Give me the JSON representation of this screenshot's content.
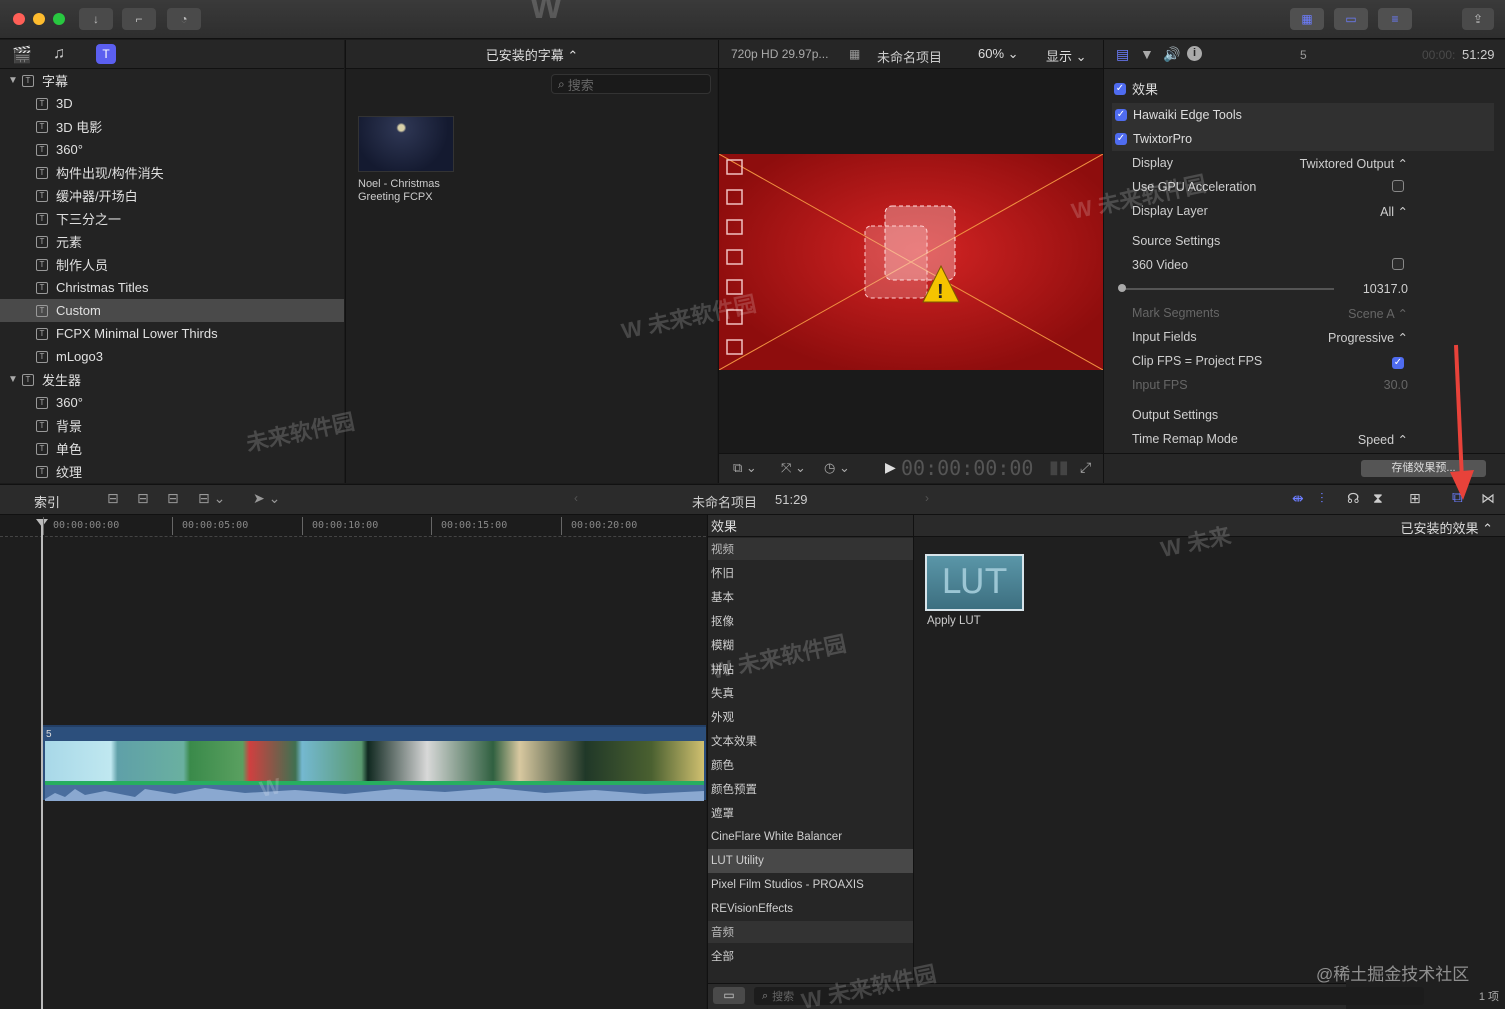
{
  "titlebar": {
    "buttons": [
      "download-icon",
      "key-icon",
      "clock-icon"
    ],
    "right_buttons": [
      "grid-icon",
      "filmstrip-icon",
      "sliders-icon",
      "share-icon"
    ]
  },
  "library": {
    "title": "已安装的字幕 ⌃",
    "search_placeholder": "搜索",
    "sections": [
      {
        "label": "字幕",
        "items": [
          "3D",
          "3D 电影",
          "360°",
          "构件出现/构件消失",
          "缓冲器/开场白",
          "下三分之一",
          "元素",
          "制作人员",
          "Christmas Titles",
          "Custom",
          "FCPX Minimal Lower Thirds",
          "mLogo3"
        ]
      },
      {
        "label": "发生器",
        "items": [
          "360°",
          "背景",
          "单色",
          "纹理"
        ]
      }
    ],
    "selected": "Custom"
  },
  "browser": {
    "clip_title": "Noel - Christmas Greeting FCPX"
  },
  "viewer": {
    "format": "720p HD 29.97p...",
    "project": "未命名项目",
    "zoom": "60% ⌄",
    "display": "显示 ⌄",
    "timecode": "00:00:00:00"
  },
  "inspector": {
    "index": "5",
    "duration_dim": "00:00:",
    "duration": "51:29",
    "effects_header": "效果",
    "rows": [
      {
        "label": "Hawaiki Edge Tools",
        "type": "effect"
      },
      {
        "label": "TwixtorPro",
        "type": "effect"
      },
      {
        "label": "Display",
        "value": "Twixtored Output ⌃"
      },
      {
        "label": "Use GPU Acceleration",
        "value": "checkbox-off"
      },
      {
        "label": "Display Layer",
        "value": "All ⌃"
      },
      {
        "label": "Source Settings",
        "value": ""
      },
      {
        "label": "360 Video",
        "value": "checkbox-off"
      },
      {
        "label": "",
        "value": "10317.0"
      },
      {
        "label": "Mark Segments",
        "value": "Scene A ⌃",
        "dim": true
      },
      {
        "label": "Input Fields",
        "value": "Progressive ⌃"
      },
      {
        "label": "Clip FPS = Project FPS",
        "value": "checkbox-on"
      },
      {
        "label": "Input FPS",
        "value": "30.0",
        "dim": true
      },
      {
        "label": "Output Settings",
        "value": ""
      },
      {
        "label": "Time Remap Mode",
        "value": "Speed ⌃"
      }
    ],
    "save_preset": "存储效果预..."
  },
  "timeline": {
    "index_label": "索引",
    "project": "未命名项目",
    "duration": "51:29",
    "ruler": [
      "00:00:00:00",
      "00:00:05:00",
      "00:00:10:00",
      "00:00:15:00",
      "00:00:20:00"
    ],
    "clip_index": "5"
  },
  "effects": {
    "header": "效果",
    "installed": "已安装的效果 ⌃",
    "categories": [
      {
        "label": "视频",
        "hdr": true
      },
      {
        "label": "怀旧"
      },
      {
        "label": "基本"
      },
      {
        "label": "抠像"
      },
      {
        "label": "模糊"
      },
      {
        "label": "拼贴"
      },
      {
        "label": "失真"
      },
      {
        "label": "外观"
      },
      {
        "label": "文本效果"
      },
      {
        "label": "颜色"
      },
      {
        "label": "颜色预置"
      },
      {
        "label": "遮罩"
      },
      {
        "label": "CineFlare White Balancer"
      },
      {
        "label": "LUT Utility",
        "sel": true
      },
      {
        "label": "Pixel Film Studios - PROAXIS"
      },
      {
        "label": "REVisionEffects"
      },
      {
        "label": "音频",
        "hdr": true
      },
      {
        "label": "全部"
      }
    ],
    "effect_name": "Apply LUT",
    "thumb_text": "LUT",
    "search_placeholder": "搜索",
    "count": "1 项"
  },
  "watermark": "@稀土掘金技术社区",
  "accent": "#4f6cf0",
  "arrow_color": "#e8423a"
}
